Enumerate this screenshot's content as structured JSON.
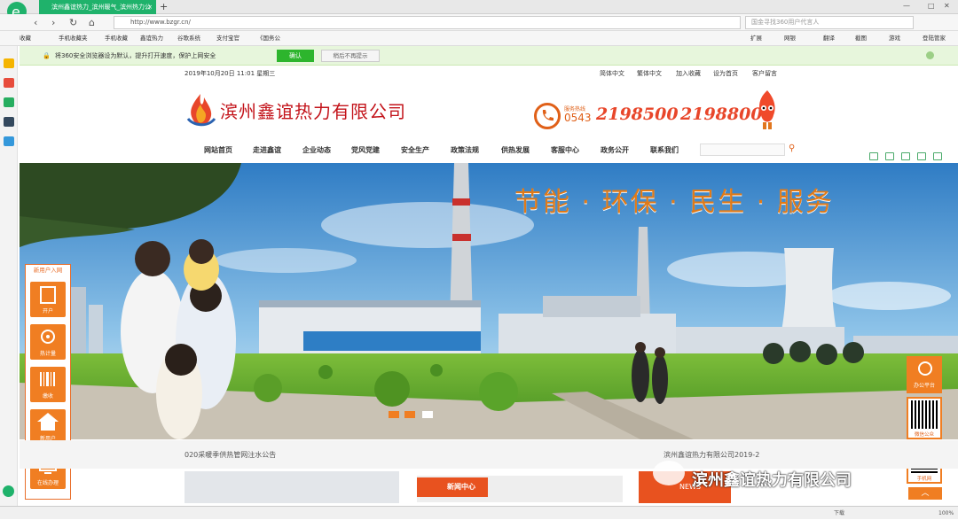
{
  "browser": {
    "tab_title": "滨州鑫谊热力_滨州暖气_滨州热力公",
    "new_tab": "+",
    "url": "http://www.bzgr.cn/",
    "search_placeholder": "国金寻找360用户代言人",
    "nav": {
      "back": "‹",
      "forward": "›",
      "reload": "↻",
      "home": "⌂"
    },
    "favorites": [
      "收藏",
      "手机收藏夹",
      "手机收藏",
      "鑫谊热力",
      "谷歌系统",
      "支付宝官",
      "《国务公"
    ],
    "toolbar_right": [
      "扩展",
      "网银",
      "翻译",
      "截图",
      "游戏",
      "登陆管家"
    ],
    "notice": "将360安全浏览器设为默认，提升打开速度，保护上网安全",
    "notice_confirm": "确认",
    "notice_dismiss": "稍后不再提示",
    "status": [
      "下载",
      "100%"
    ]
  },
  "site": {
    "date": "2019年10月20日  11:01  星期三",
    "top_links": [
      "简体中文",
      "繁体中文",
      "加入收藏",
      "设为首页",
      "客户留言"
    ],
    "logo_text": "滨州鑫谊热力有限公司",
    "hotline_label": "服务热线",
    "hotline_code": "0543",
    "hotline_1": "2198500",
    "hotline_2": "2198800",
    "menu": [
      "网站首页",
      "走进鑫谊",
      "企业动态",
      "党风党建",
      "安全生产",
      "政策法规",
      "供热发展",
      "客服中心",
      "政务公开",
      "联系我们"
    ],
    "slogan": "节能 · 环保 · 民生 · 服务",
    "new_user": {
      "title": "新用户入网",
      "buttons": [
        "开户",
        "热计量",
        "缴收",
        "新用户",
        "在线办理"
      ]
    },
    "right_panel": [
      "办公平台",
      "微信公众",
      "手机网"
    ],
    "ticker_left": "020采暖季供热管网注水公告",
    "ticker_right": "滨州鑫谊热力有限公司2019-2",
    "news_head": "新闻中心",
    "news_head_en": "NEWS",
    "watermark": "滨州鑫谊热力有限公司"
  },
  "colors": {
    "accent": "#f07e22",
    "brand_red": "#c3131a",
    "browser_green": "#1fb26b"
  }
}
